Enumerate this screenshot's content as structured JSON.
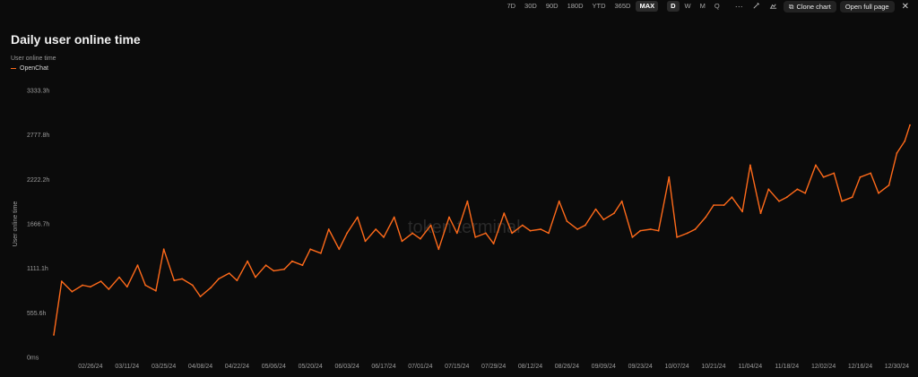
{
  "toolbar": {
    "ranges": [
      "7D",
      "30D",
      "90D",
      "180D",
      "YTD",
      "365D",
      "MAX"
    ],
    "active_range": "MAX",
    "intervals": [
      "D",
      "W",
      "M",
      "Q"
    ],
    "active_interval": "D",
    "more_glyph": "···",
    "clone_label": "Clone chart",
    "open_label": "Open full page"
  },
  "header": {
    "title": "Daily user online time"
  },
  "legend": {
    "title": "User online time",
    "series_name": "OpenChat"
  },
  "watermark": "token terminal",
  "colors": {
    "line": "#ff6a1a",
    "background": "#0b0b0b"
  },
  "chart_data": {
    "type": "line",
    "title": "Daily user online time",
    "ylabel": "User online time",
    "xlabel": "",
    "ylim": [
      0,
      3333.3
    ],
    "yticks": [
      0,
      555.6,
      1111.1,
      1666.7,
      2222.2,
      2777.8,
      3333.3
    ],
    "ytick_labels": [
      "0ms",
      "555.6h",
      "1111.1h",
      "1666.7h",
      "2222.2h",
      "2777.8h",
      "3333.3h"
    ],
    "xtick_labels": [
      "02/26/24",
      "03/11/24",
      "03/25/24",
      "04/08/24",
      "04/22/24",
      "05/06/24",
      "05/20/24",
      "06/03/24",
      "06/17/24",
      "07/01/24",
      "07/15/24",
      "07/29/24",
      "08/12/24",
      "08/26/24",
      "09/09/24",
      "09/23/24",
      "10/07/24",
      "10/21/24",
      "11/04/24",
      "11/18/24",
      "12/02/24",
      "12/16/24",
      "12/30/24"
    ],
    "grid": false,
    "legend_position": "top-left",
    "series": [
      {
        "name": "OpenChat",
        "x": [
          "02/12/24",
          "02/15/24",
          "02/19/24",
          "02/23/24",
          "02/26/24",
          "03/01/24",
          "03/04/24",
          "03/08/24",
          "03/11/24",
          "03/15/24",
          "03/18/24",
          "03/22/24",
          "03/25/24",
          "03/29/24",
          "04/01/24",
          "04/05/24",
          "04/08/24",
          "04/12/24",
          "04/15/24",
          "04/19/24",
          "04/22/24",
          "04/26/24",
          "04/29/24",
          "05/03/24",
          "05/06/24",
          "05/10/24",
          "05/13/24",
          "05/17/24",
          "05/20/24",
          "05/24/24",
          "05/27/24",
          "05/31/24",
          "06/03/24",
          "06/07/24",
          "06/10/24",
          "06/14/24",
          "06/17/24",
          "06/21/24",
          "06/24/24",
          "06/28/24",
          "07/01/24",
          "07/05/24",
          "07/08/24",
          "07/12/24",
          "07/15/24",
          "07/19/24",
          "07/22/24",
          "07/26/24",
          "07/29/24",
          "08/02/24",
          "08/05/24",
          "08/09/24",
          "08/12/24",
          "08/16/24",
          "08/19/24",
          "08/23/24",
          "08/26/24",
          "08/30/24",
          "09/02/24",
          "09/06/24",
          "09/09/24",
          "09/13/24",
          "09/16/24",
          "09/20/24",
          "09/23/24",
          "09/27/24",
          "09/30/24",
          "10/04/24",
          "10/07/24",
          "10/11/24",
          "10/14/24",
          "10/18/24",
          "10/21/24",
          "10/25/24",
          "10/28/24",
          "11/01/24",
          "11/04/24",
          "11/08/24",
          "11/11/24",
          "11/15/24",
          "11/18/24",
          "11/22/24",
          "11/25/24",
          "11/29/24",
          "12/02/24",
          "12/06/24",
          "12/09/24",
          "12/13/24",
          "12/16/24",
          "12/20/24",
          "12/23/24",
          "12/27/24",
          "12/30/24",
          "01/02/25",
          "01/04/25"
        ],
        "values": [
          280,
          950,
          820,
          900,
          880,
          950,
          850,
          1000,
          880,
          1150,
          900,
          830,
          1350,
          960,
          980,
          900,
          760,
          870,
          980,
          1050,
          960,
          1200,
          1000,
          1150,
          1080,
          1100,
          1200,
          1150,
          1350,
          1300,
          1600,
          1350,
          1550,
          1750,
          1450,
          1600,
          1500,
          1750,
          1450,
          1550,
          1480,
          1650,
          1350,
          1750,
          1550,
          1950,
          1500,
          1550,
          1420,
          1800,
          1550,
          1650,
          1580,
          1600,
          1550,
          1950,
          1700,
          1600,
          1650,
          1850,
          1720,
          1800,
          1950,
          1500,
          1580,
          1600,
          1580,
          2250,
          1500,
          1550,
          1600,
          1750,
          1900,
          1900,
          2000,
          1820,
          2400,
          1800,
          2100,
          1950,
          2000,
          2100,
          2050,
          2400,
          2250,
          2300,
          1950,
          2000,
          2250,
          2300,
          2050,
          2150,
          2550,
          2700,
          2900
        ]
      }
    ]
  }
}
